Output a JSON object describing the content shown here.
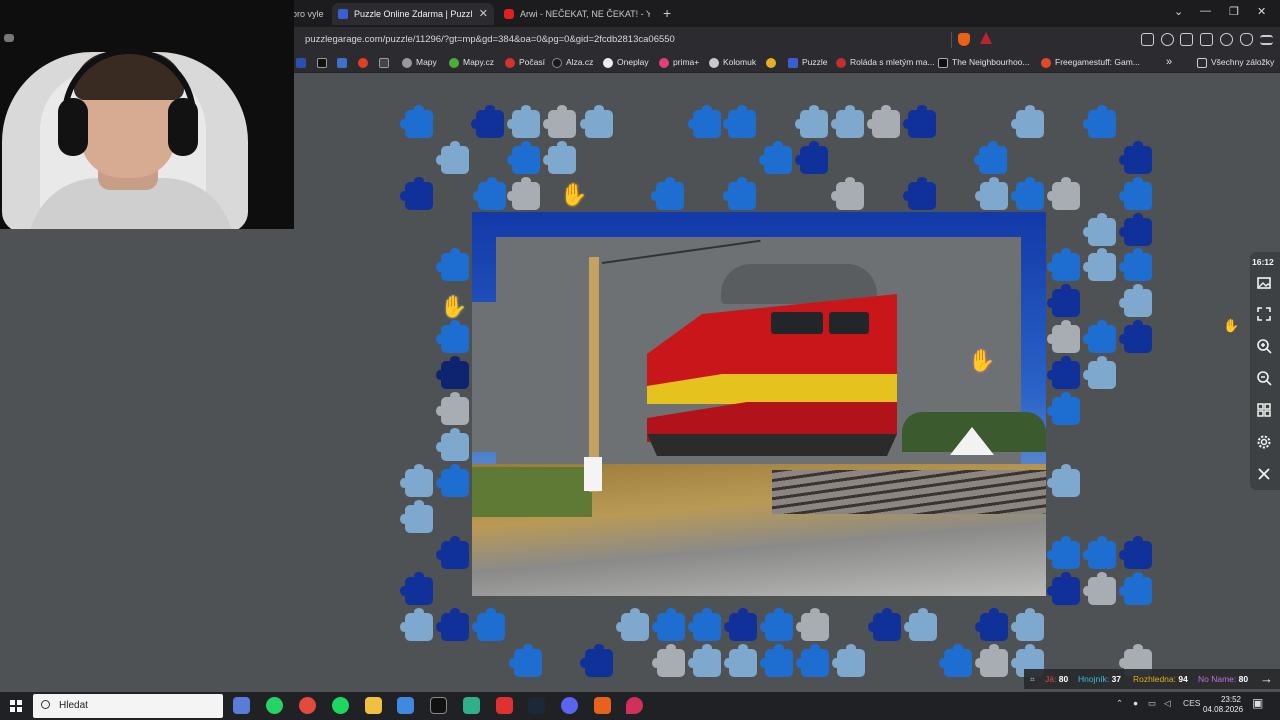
{
  "browser": {
    "tabs": [
      {
        "label": "oro vyle",
        "active": false
      },
      {
        "label": "Puzzle Online Zdarma | Puzzl",
        "active": true
      },
      {
        "label": "Arwi - NEČEKAT, NE ČEKAT! - You",
        "active": false
      }
    ],
    "url": "puzzlegarage.com/puzzle/11296/?gt=mp&gd=384&oa=0&pg=0&gid=2fcdb2813ca06550",
    "bookmarks": [
      "Mapy",
      "Mapy.cz",
      "Počasí",
      "Alza.cz",
      "Oneplay",
      "prima+",
      "Kolomuk",
      "Puzzle",
      "Roláda s mletým ma...",
      "The Neighbourhoo...",
      "Freegamestuff: Gam..."
    ],
    "bookmarks_more": "»",
    "all_bookmarks": "Všechny záložky",
    "newtab": "+",
    "tab_close": "✕",
    "window_controls": [
      "⌄",
      "—",
      "❐",
      "✕"
    ]
  },
  "game": {
    "timer": "16:12",
    "players": [
      {
        "name": "Já:",
        "score": "80",
        "color": "#e04848"
      },
      {
        "name": "Hnojník:",
        "score": "37",
        "color": "#3fb8e8"
      },
      {
        "name": "Rozhledna:",
        "score": "94",
        "color": "#e0b020"
      },
      {
        "name": "No Name:",
        "score": "80",
        "color": "#c070e0"
      }
    ],
    "tools": [
      "image-icon",
      "fullscreen-icon",
      "zoom-in-icon",
      "zoom-out-icon",
      "grid-icon",
      "settings-icon",
      "close-icon"
    ]
  },
  "taskbar": {
    "search_placeholder": "Hledat",
    "language": "CES",
    "time": "23:52",
    "date": "04.08.2026"
  },
  "colors": {
    "background": "#4f5254",
    "chrome": "#2c2c30",
    "tabbar": "#1c1c1e"
  }
}
